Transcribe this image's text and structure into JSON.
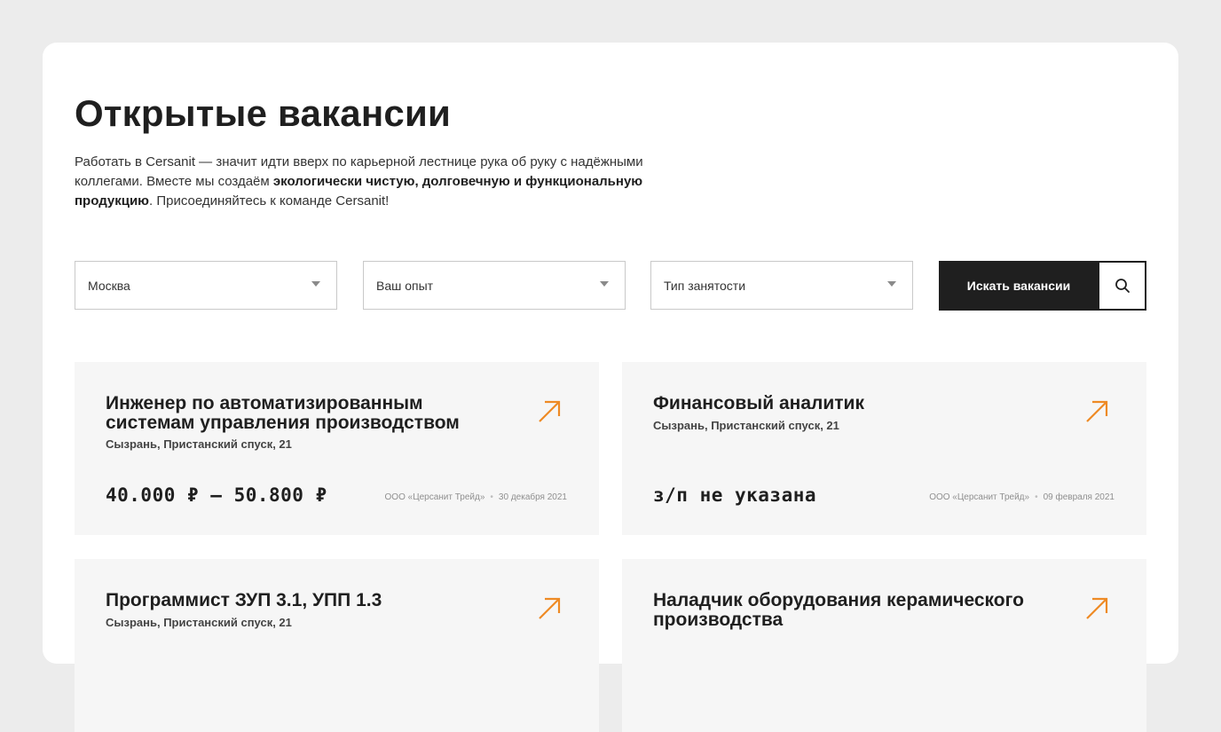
{
  "header": {
    "title": "Открытые вакансии",
    "intro_1": "Работать в Cersanit — значит идти вверх по карьерной лестнице рука об руку с надёжными коллегами. Вместе мы создаём ",
    "intro_bold": "экологически чистую, долговечную и функциональную продукцию",
    "intro_2": ". Присоединяйтесь к команде Cersanit!"
  },
  "filters": {
    "city": "Москва",
    "experience": "Ваш опыт",
    "employment": "Тип занятости",
    "search_label": "Искать вакансии"
  },
  "vacancies": [
    {
      "title": "Инженер по автоматизированным системам управления производством",
      "address": "Сызрань, Пристанский спуск, 21",
      "salary": "40.000 ₽ – 50.800 ₽",
      "company": "ООО «Церсанит Трейд»",
      "date": "30 декабря 2021"
    },
    {
      "title": "Финансовый аналитик",
      "address": "Сызрань, Пристанский спуск, 21",
      "salary": "з/п не указана",
      "company": "ООО «Церсанит Трейд»",
      "date": "09 февраля 2021"
    },
    {
      "title": "Программист ЗУП 3.1, УПП 1.3",
      "address": "Сызрань, Пристанский спуск, 21"
    },
    {
      "title": "Наладчик оборудования керамического производства"
    }
  ],
  "colors": {
    "accent": "#ee8a24",
    "dark": "#1f1f1f",
    "card_bg": "#f6f6f6"
  },
  "icons": {
    "arrow": "arrow-up-right-icon",
    "search": "search-icon",
    "caret": "caret-down-icon"
  }
}
